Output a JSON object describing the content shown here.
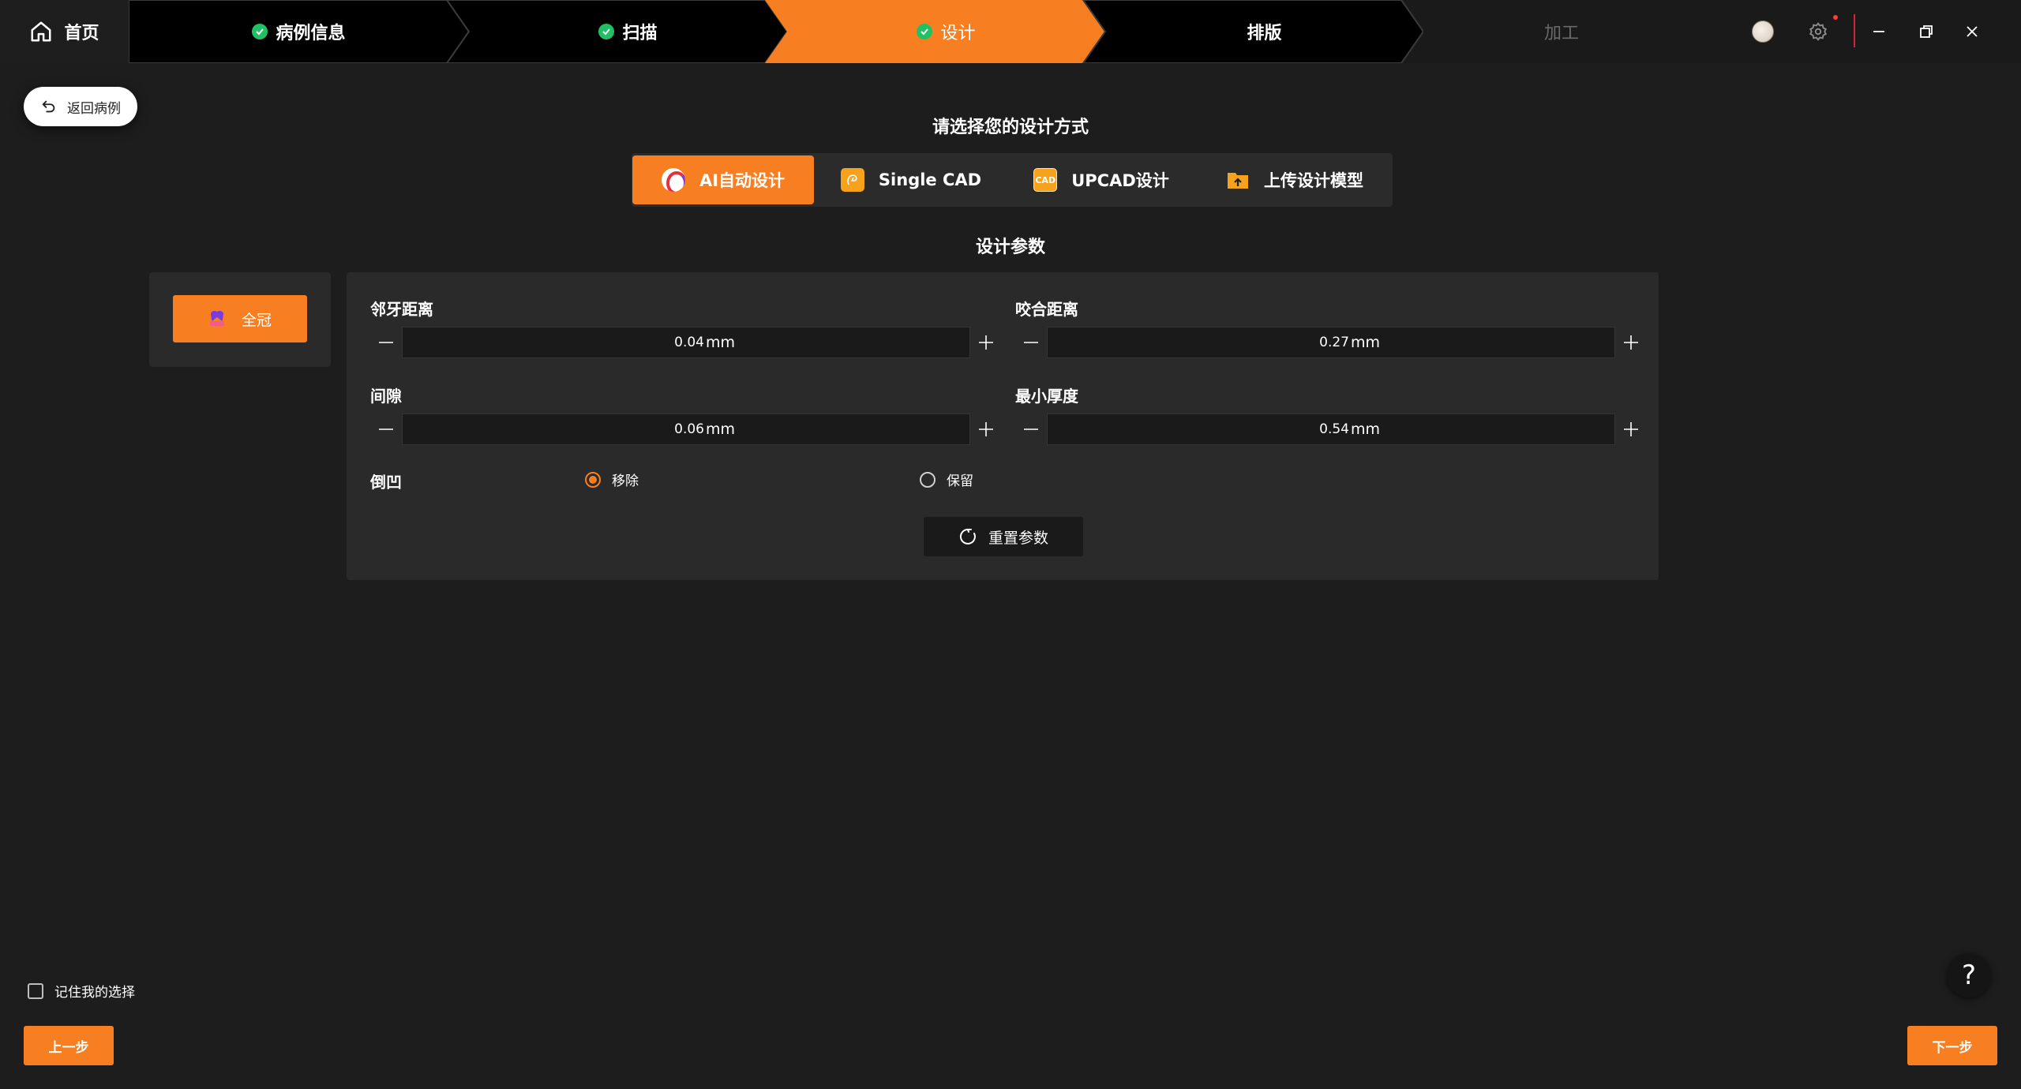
{
  "topbar": {
    "home_label": "首页",
    "steps": [
      {
        "label": "病例信息",
        "status": "done"
      },
      {
        "label": "扫描",
        "status": "done"
      },
      {
        "label": "设计",
        "status": "active"
      },
      {
        "label": "排版",
        "status": "pending"
      },
      {
        "label": "加工",
        "status": "disabled"
      }
    ],
    "icons": [
      "avatar",
      "gear-icon",
      "minimize-icon",
      "restore-icon",
      "close-icon"
    ]
  },
  "back_button": {
    "label": "返回病例"
  },
  "method_section": {
    "title": "请选择您的设计方式",
    "options": [
      {
        "label": "AI自动设计",
        "icon": "ai-icon",
        "selected": true
      },
      {
        "label": "Single CAD",
        "icon": "single-cad-icon",
        "selected": false
      },
      {
        "label": "UPCAD设计",
        "icon": "cad-icon",
        "icon_text": "CAD",
        "selected": false
      },
      {
        "label": "上传设计模型",
        "icon": "upload-folder-icon",
        "selected": false
      }
    ]
  },
  "params_section": {
    "title": "设计参数",
    "crown_type": {
      "label": "全冠",
      "selected": true
    },
    "fields": {
      "adjacent": {
        "label": "邻牙距离",
        "value": "0.04",
        "unit": "mm"
      },
      "occlusal": {
        "label": "咬合距离",
        "value": "0.27",
        "unit": "mm"
      },
      "gap": {
        "label": "间隙",
        "value": "0.06",
        "unit": "mm"
      },
      "min_thickness": {
        "label": "最小厚度",
        "value": "0.54",
        "unit": "mm"
      }
    },
    "undercut": {
      "label": "倒凹",
      "options": [
        {
          "label": "移除",
          "selected": true
        },
        {
          "label": "保留",
          "selected": false
        }
      ]
    },
    "reset_label": "重置参数"
  },
  "footer": {
    "remember_label": "记住我的选择",
    "remember_checked": false,
    "prev_label": "上一步",
    "next_label": "下一步",
    "help_symbol": "?"
  },
  "colors": {
    "accent": "#f77f22",
    "success": "#21c064",
    "background": "#1d1d1d",
    "panel": "#2a2a2a"
  }
}
